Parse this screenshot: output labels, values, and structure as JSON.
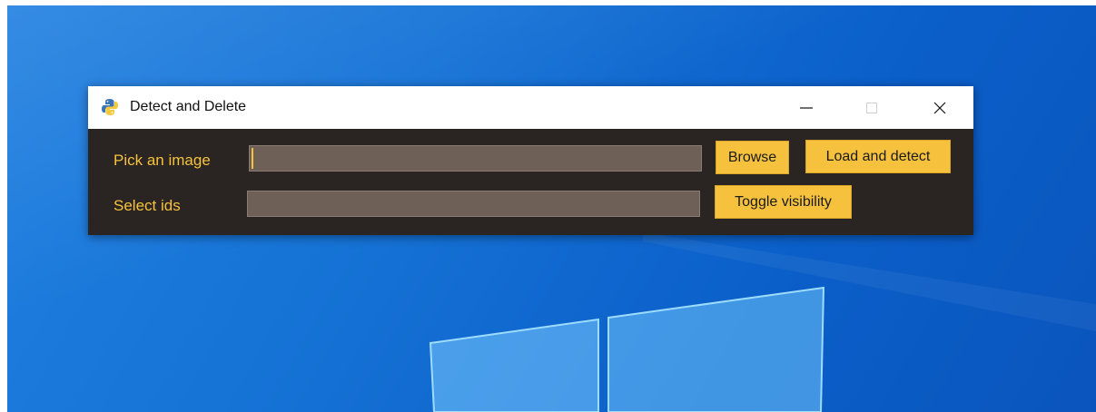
{
  "window": {
    "title": "Detect and Delete",
    "icon": "python-icon"
  },
  "titlebar_controls": {
    "minimize_icon": "minimize-icon",
    "maximize_icon": "maximize-icon",
    "close_icon": "close-icon"
  },
  "form": {
    "pick_label": "Pick an image",
    "pick_value": "",
    "ids_label": "Select ids",
    "ids_value": "",
    "browse_label": "Browse",
    "load_label": "Load and detect",
    "toggle_label": "Toggle visibility"
  },
  "colors": {
    "accent": "#f6c23d",
    "window_bg": "#2a2522",
    "field_bg": "#6e5f57",
    "desktop": "#1673d6"
  }
}
